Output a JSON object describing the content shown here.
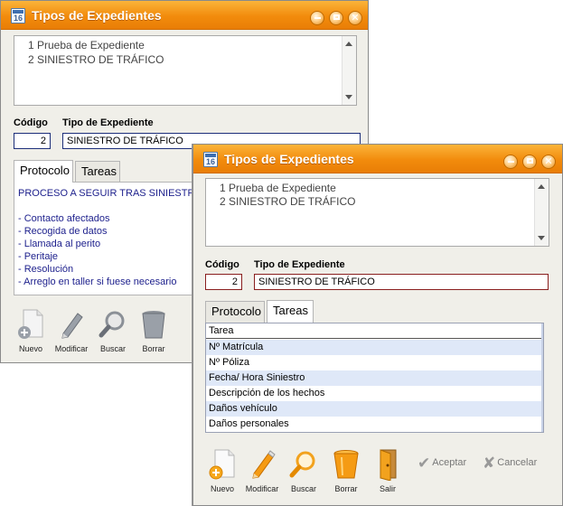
{
  "window1": {
    "title": "Tipos de Expedientes",
    "icon_label": "16",
    "list": [
      "1 Prueba de Expediente",
      "2 SINIESTRO DE TRÁFICO"
    ],
    "codigo_label": "Código",
    "tipo_label": "Tipo de Expediente",
    "codigo_value": "2",
    "tipo_value": "SINIESTRO DE TRÁFICO",
    "tabs": [
      "Protocolo",
      "Tareas"
    ],
    "protocol_lines": [
      "PROCESO A SEGUIR TRAS SINIESTRO",
      "",
      "- Contacto afectados",
      "- Recogida de datos",
      "- Llamada al perito",
      "- Peritaje",
      "- Resolución",
      "- Arreglo en taller si fuese necesario"
    ],
    "toolbar": [
      {
        "icon": "new-document-icon",
        "label": "Nuevo"
      },
      {
        "icon": "pencil-icon",
        "label": "Modificar"
      },
      {
        "icon": "magnifier-icon",
        "label": "Buscar"
      },
      {
        "icon": "trash-icon",
        "label": "Borrar"
      }
    ]
  },
  "window2": {
    "title": "Tipos de Expedientes",
    "icon_label": "16",
    "list": [
      "1 Prueba de Expediente",
      "2 SINIESTRO DE TRÁFICO"
    ],
    "codigo_label": "Código",
    "tipo_label": "Tipo de Expediente",
    "codigo_value": "2",
    "tipo_value": "SINIESTRO DE TRÁFICO",
    "tabs": [
      "Protocolo",
      "Tareas"
    ],
    "grid_header": "Tarea",
    "tasks": [
      "Nº Matrícula",
      "Nº Póliza",
      "Fecha/ Hora Siniestro",
      "Descripción de los hechos",
      "Daños vehículo",
      "Daños personales"
    ],
    "toolbar": [
      {
        "icon": "new-document-icon",
        "label": "Nuevo"
      },
      {
        "icon": "pencil-icon",
        "label": "Modificar"
      },
      {
        "icon": "magnifier-icon",
        "label": "Buscar"
      },
      {
        "icon": "bucket-icon",
        "label": "Borrar"
      },
      {
        "icon": "door-exit-icon",
        "label": "Salir"
      }
    ],
    "accept_label": "Aceptar",
    "cancel_label": "Cancelar"
  },
  "colors": {
    "titlebar": "#f28b0c",
    "protocol_text": "#1c1f8c",
    "row_highlight": "#dfe8f8"
  }
}
